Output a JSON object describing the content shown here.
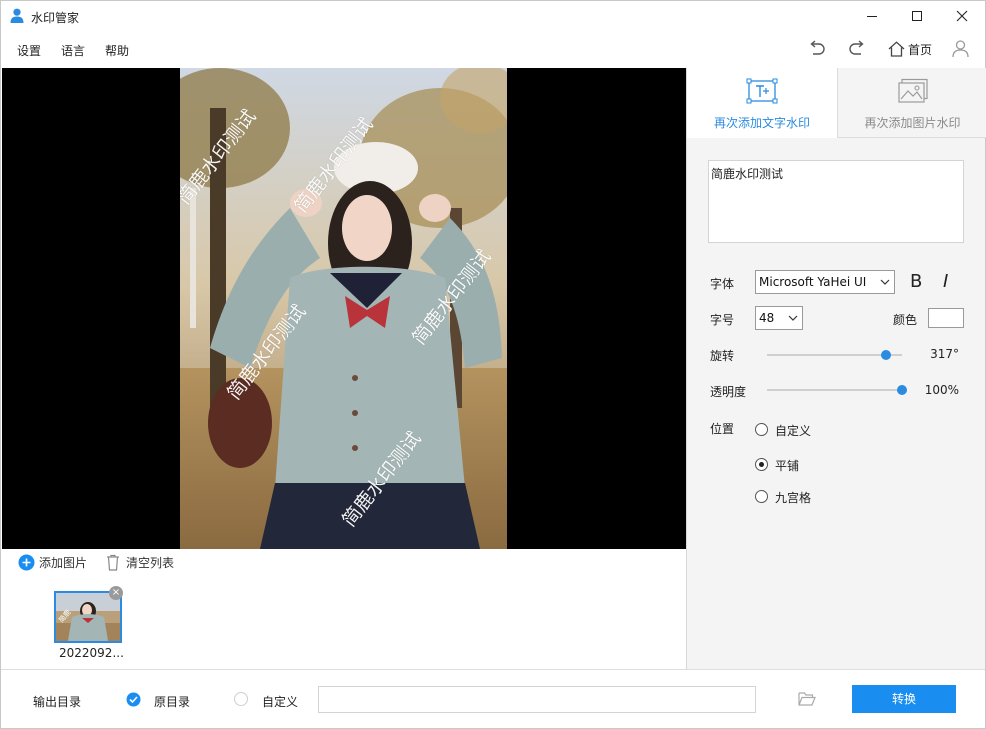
{
  "window": {
    "title": "水印管家"
  },
  "menu": {
    "items": [
      "设置",
      "语言",
      "帮助"
    ],
    "home_label": "首页"
  },
  "icons": {
    "app": "user-icon",
    "undo": "undo-icon",
    "redo": "redo-icon",
    "home": "home-icon",
    "account": "person-icon",
    "minimize": "minimize-icon",
    "maximize": "maximize-icon",
    "close": "close-icon",
    "add": "plus-circle-icon",
    "clear": "trash-icon",
    "folder": "folder-open-icon",
    "check": "checkmark-icon"
  },
  "preview": {
    "watermark_text": "简鹿水印测试",
    "tile_count": 5
  },
  "list": {
    "add_label": "添加图片",
    "clear_label": "清空列表",
    "items": [
      {
        "name": "2022092..."
      }
    ]
  },
  "panel": {
    "tabs": [
      {
        "label": "再次添加文字水印",
        "active": true
      },
      {
        "label": "再次添加图片水印",
        "active": false
      }
    ],
    "text_value": "简鹿水印测试",
    "font_label": "字体",
    "font_value": "Microsoft YaHei UI",
    "bold_label": "B",
    "italic_label": "I",
    "size_label": "字号",
    "size_value": "48",
    "color_label": "颜色",
    "rotation": {
      "label": "旋转",
      "value": "317°",
      "fraction": 0.88
    },
    "opacity": {
      "label": "透明度",
      "value": "100%",
      "fraction": 1.0
    },
    "position": {
      "label": "位置",
      "options": [
        {
          "label": "自定义",
          "selected": false
        },
        {
          "label": "平铺",
          "selected": true
        },
        {
          "label": "九宫格",
          "selected": false
        }
      ]
    }
  },
  "bottom": {
    "output_label": "输出目录",
    "original_dir_label": "原目录",
    "custom_label": "自定义",
    "path_value": "",
    "convert_label": "转换"
  },
  "colors": {
    "accent": "#1a8df0",
    "panel_bg": "#f4f4f5"
  }
}
